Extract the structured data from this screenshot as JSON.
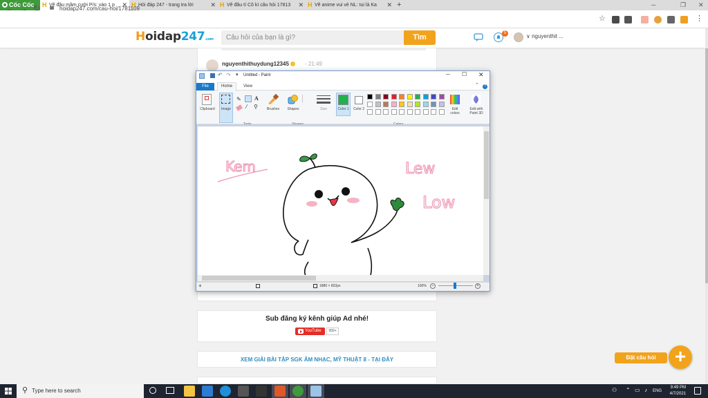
{
  "browser": {
    "brand": "Cốc Cốc",
    "tabs": [
      {
        "title": "Vẽ đầu mầm cười P/s: vào 1 p"
      },
      {
        "title": "Hỏi đáp 247 - trang tra lời"
      },
      {
        "title": "Vẽ đầu tí Cô kì câu hỏi 17813"
      },
      {
        "title": "Vẽ anime vui vẻ NL: tui là Ka"
      }
    ],
    "url": "hoidap247.com/cau-hoi/1781109"
  },
  "site": {
    "logo_h": "H",
    "logo_rest": "oidap",
    "logo_num": "247",
    "logo_sub": ".com",
    "search_placeholder": "Câu hỏi của bạn là gì?",
    "search_button": "Tìm",
    "notification_count": "5",
    "username": "nguyenthit ...",
    "poster_name": "nguyenthithuydung12345",
    "poster_time": "- 21:49",
    "sub_title": "Sub đăng ký kênh giúp Ad nhé!",
    "youtube_label": "YouTube",
    "youtube_count": "999+",
    "xem_link": "XEM GIẢI BÀI TẬP SGK ÂM NHẠC, MỸ THUẬT 8 - TẠI ĐÂY",
    "ask_button": "Đặt câu hỏi",
    "plus": "+"
  },
  "paint": {
    "title": "Untitled - Paint",
    "menu": {
      "file": "File",
      "home": "Home",
      "view": "View"
    },
    "ribbon": {
      "clipboard": "Clipboard",
      "image": "Image",
      "tools": "Tools",
      "brushes": "Brushes",
      "shapes": "Shapes",
      "shapes_group": "Shapes",
      "size": "Size",
      "color1": "Color 1",
      "color2": "Color 2",
      "colors_group": "Colors",
      "edit_colors": "Edit colors",
      "edit_paint3d": "Edit with Paint 3D"
    },
    "palette_row1": [
      "#000000",
      "#7f7f7f",
      "#880015",
      "#ed1c24",
      "#ff7f27",
      "#fff200",
      "#22b14c",
      "#00a2e8",
      "#3f48cc",
      "#a349a4"
    ],
    "palette_row2": [
      "#ffffff",
      "#c3c3c3",
      "#b97a57",
      "#ffaec9",
      "#ffc90e",
      "#efe4b0",
      "#b5e61d",
      "#99d9ea",
      "#7092be",
      "#c8bfe7"
    ],
    "primary_color": "#22b14c",
    "drawing_text": {
      "kem": "Kem",
      "lew": "Lew",
      "low": "Low"
    },
    "status": {
      "dimensions": "1880 × 822px",
      "zoom": "100%"
    }
  },
  "taskbar": {
    "search_placeholder": "Type here to search",
    "lang": "ENG",
    "time": "9:49 PM",
    "date": "4/7/2021"
  }
}
